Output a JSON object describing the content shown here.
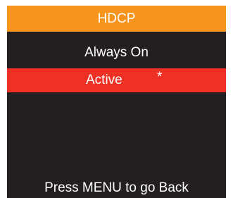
{
  "header": {
    "title": "HDCP"
  },
  "menu": {
    "items": [
      {
        "label": "Always On",
        "selected": false
      },
      {
        "label": "Active",
        "selected": true,
        "marker": "*"
      }
    ]
  },
  "footer": {
    "hint": "Press MENU to go Back"
  },
  "colors": {
    "header_bg": "#f7941d",
    "screen_bg": "#231f20",
    "selected_bg": "#ee3124",
    "text": "#ffffff"
  }
}
